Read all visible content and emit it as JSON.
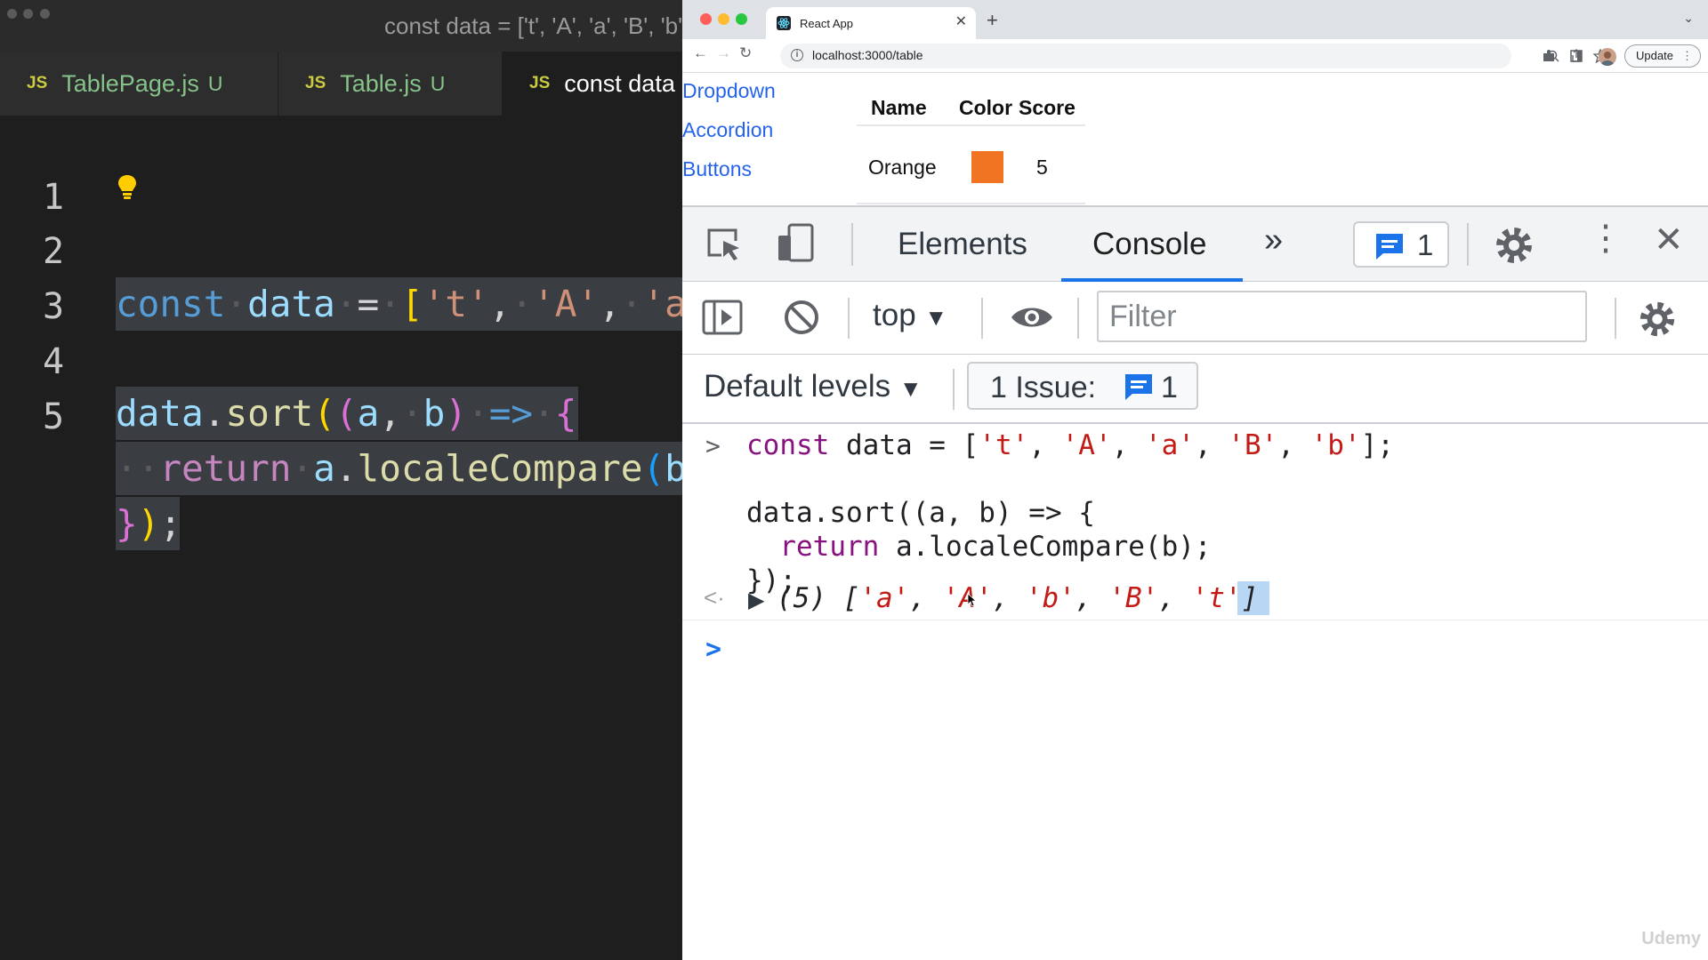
{
  "editor": {
    "window_title": "const data = ['t', 'A', 'a', 'B', 'b'];",
    "tabs": [
      {
        "icon": "JS",
        "name": "TablePage.js",
        "status": "U"
      },
      {
        "icon": "JS",
        "name": "Table.js",
        "status": "U"
      },
      {
        "icon": "JS",
        "name": "const data"
      }
    ],
    "line_numbers": [
      "1",
      "2",
      "3",
      "4",
      "5"
    ]
  },
  "browser": {
    "tab_title": "React App",
    "url": "localhost:3000/table",
    "update_label": "Update",
    "page": {
      "nav_links": [
        "Dropdown",
        "Accordion",
        "Buttons"
      ],
      "table": {
        "headers": [
          "Name",
          "Color",
          "Score"
        ],
        "rows": [
          {
            "name": "Orange",
            "color": "#f07422",
            "score": "5"
          }
        ]
      }
    },
    "devtools": {
      "tabs": [
        "Elements",
        "Console"
      ],
      "active_tab": "Console",
      "issues_count": "1",
      "context": "top",
      "filter_placeholder": "Filter",
      "levels": "Default levels",
      "issue_label": "1 Issue:",
      "issue_count": "1",
      "console": {
        "input_lines": [
          "const data = ['t', 'A', 'a', 'B', 'b'];",
          "",
          "data.sort((a, b) => {",
          "  return a.localeCompare(b);",
          "});"
        ],
        "result_count": "(5)",
        "result_items": [
          "'a'",
          "'A'",
          "'b'",
          "'B'",
          "'t'"
        ]
      }
    }
  },
  "watermark": "Udemy"
}
